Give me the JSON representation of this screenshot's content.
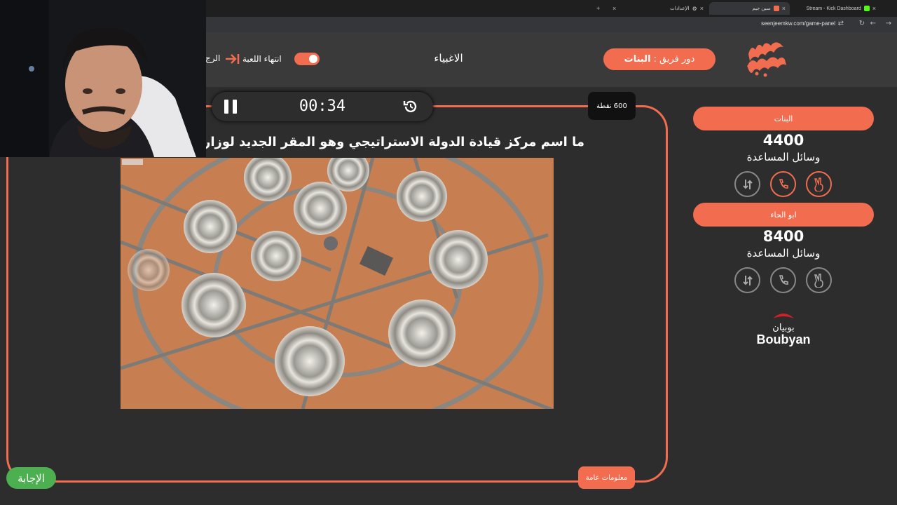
{
  "browser": {
    "tabs": [
      {
        "label": "Stream - Kick Dashboard"
      },
      {
        "label": "سين جيم"
      },
      {
        "label": "الإعدادات"
      }
    ],
    "url": "seenjeemkw.com/game-panel"
  },
  "header": {
    "turn_prefix": "دور فريق :",
    "turn_team": "البنات",
    "category": "الاغبياء",
    "end_game_label": "انتهاء اللعبة",
    "back_label": "الرج"
  },
  "timer": {
    "time": "00:34"
  },
  "question": {
    "points_label": "600 نقطة",
    "text": "ما اسم مركز قيادة الدولة الاستراتيجي وهو المقر الجديد لوزارة"
  },
  "buttons": {
    "answer": "الإجابة",
    "info": "معلومات عامة"
  },
  "teams": [
    {
      "name": "البنات",
      "score": "4400",
      "aids_label": "وسائل المساعدة"
    },
    {
      "name": "ابو الحاء",
      "score": "8400",
      "aids_label": "وسائل المساعدة"
    }
  ],
  "sponsor": {
    "name": "Boubyan",
    "arabic": "بوبيان"
  },
  "colors": {
    "accent": "#f26c4f",
    "answer": "#4caf50",
    "background": "#2d2d2d"
  }
}
